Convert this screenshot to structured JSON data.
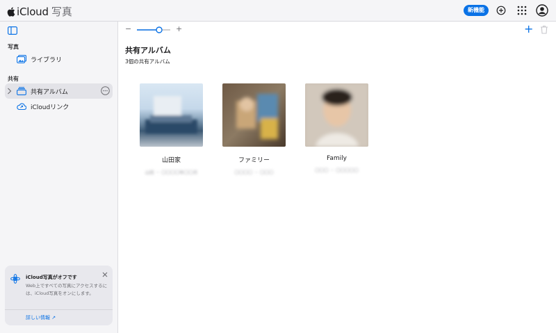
{
  "app": {
    "brand": "iCloud",
    "section": "写真",
    "new_badge": "新機能"
  },
  "topbar": {
    "icons": [
      "plus-circle-icon",
      "app-grid-icon",
      "account-icon"
    ]
  },
  "sidebar": {
    "photos_heading": "写真",
    "library_label": "ライブラリ",
    "shared_heading": "共有",
    "shared_albums_label": "共有アルバム",
    "icloud_links_label": "iCloudリンク"
  },
  "notice": {
    "title": "iCloud写真がオフです",
    "body": "Web上ですべての写真にアクセスするには、iCloud写真をオンにします。",
    "link": "詳しい情報 ↗"
  },
  "main": {
    "title": "共有アルバム",
    "subtitle": "3個の共有アルバム",
    "albums": [
      {
        "name": "山田家",
        "meta": "山田 ・ 〇〇〇〇年〇〇月"
      },
      {
        "name": "ファミリー",
        "meta": "〇〇〇〇 ・ 〇〇〇"
      },
      {
        "name": "Family",
        "meta": "〇〇〇 ・ 〇〇〇〇〇"
      }
    ]
  },
  "colors": {
    "accent": "#0a72e6",
    "sidebar_bg": "#f5f5f7",
    "active_item_bg": "#e3e3e8"
  }
}
